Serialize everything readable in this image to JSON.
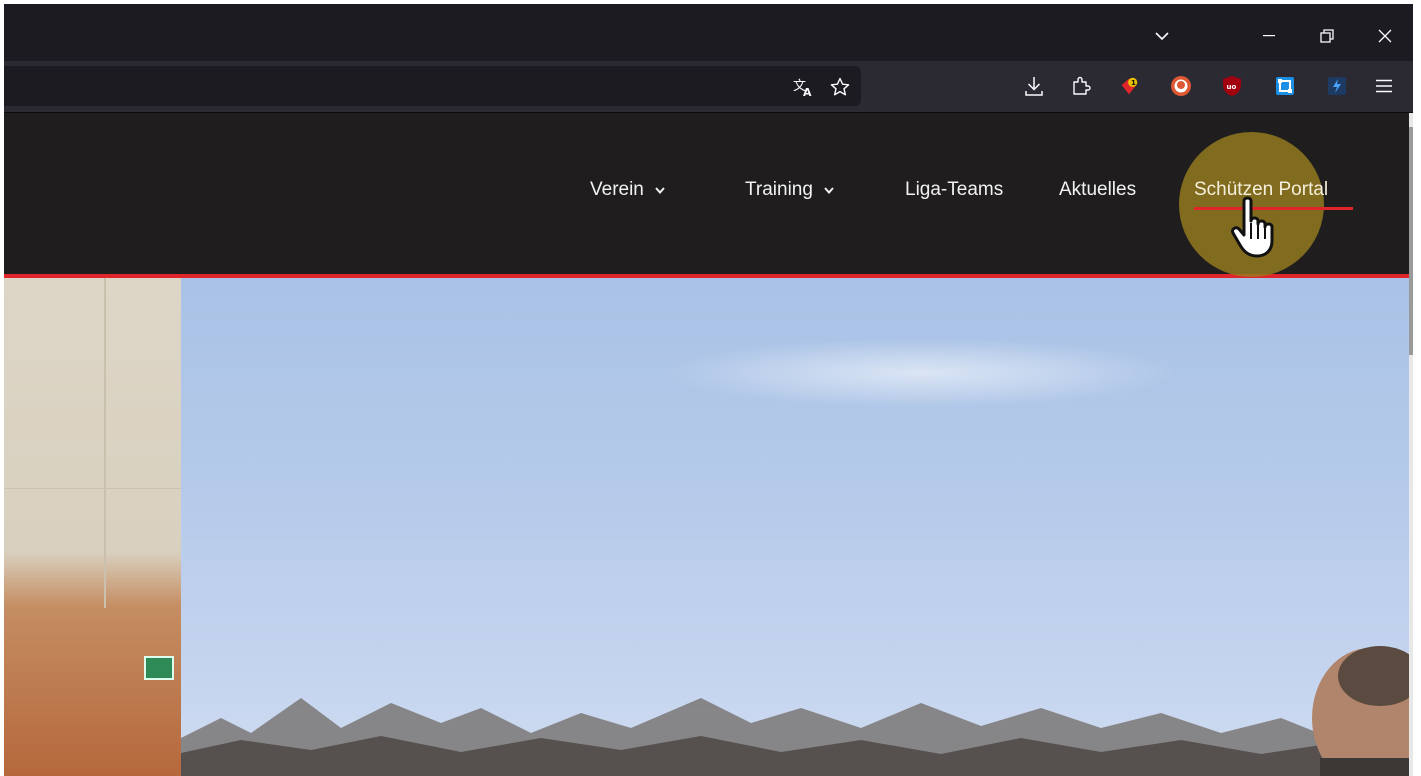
{
  "browser": {
    "window_controls": [
      "tab-list",
      "minimize",
      "restore",
      "close"
    ],
    "urlbar_icons": [
      "translate-icon",
      "bookmark-star-icon"
    ],
    "toolbar_icons": [
      "download-icon",
      "extensions-icon",
      "extension-red-badge-icon",
      "duckduckgo-icon",
      "ublock-icon",
      "extension-blue-icon",
      "extension-dark-icon",
      "menu-icon"
    ],
    "extension_badge_count": "1"
  },
  "site": {
    "nav": {
      "items": [
        {
          "label": "Verein",
          "has_dropdown": true
        },
        {
          "label": "Training",
          "has_dropdown": true
        },
        {
          "label": "Liga-Teams",
          "has_dropdown": false
        },
        {
          "label": "Aktuelles",
          "has_dropdown": false
        },
        {
          "label": "Schützen Portal",
          "has_dropdown": false,
          "active": true
        }
      ]
    },
    "colors": {
      "header_bg": "#1f1d1e",
      "accent_red": "#e0262a",
      "click_highlight": "#967d1e"
    }
  }
}
